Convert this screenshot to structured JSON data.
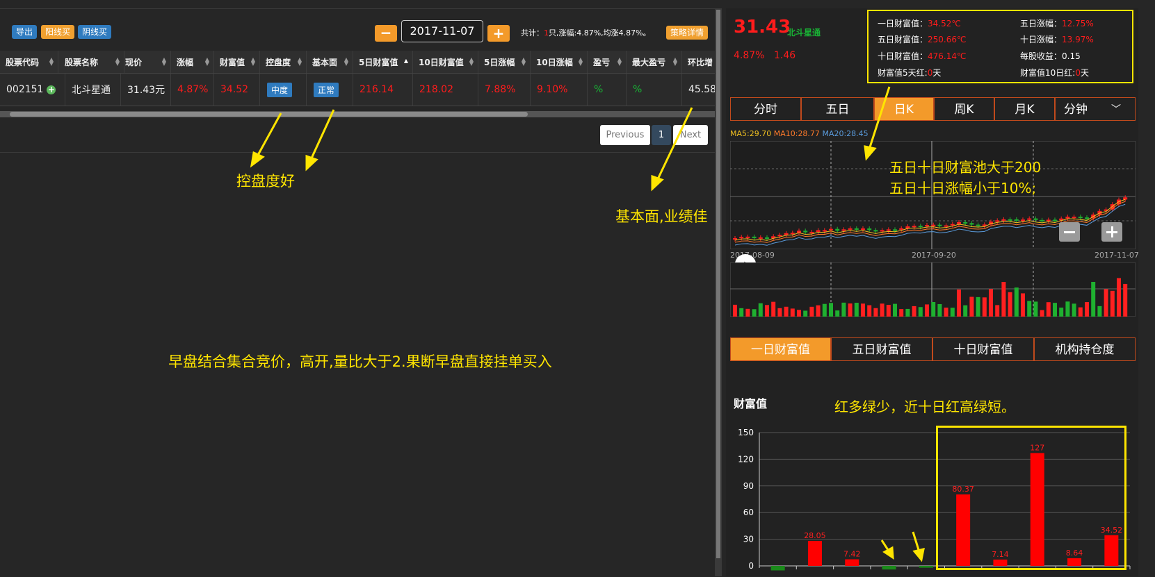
{
  "toolbar": {
    "export_label": "导出",
    "yang_buy_label": "阳线买",
    "yin_buy_label": "阴线买",
    "date_value": "2017-11-07",
    "minus_label": "−",
    "plus_label": "+",
    "summary_prefix": "共计：",
    "summary_count": "1",
    "summary_rest": "只,涨幅:4.87%,均涨4.87%。",
    "strategy_label": "策略详情"
  },
  "table": {
    "headers": [
      "股票代码",
      "股票名称",
      "现价",
      "涨幅",
      "财富值",
      "控盘度",
      "基本面",
      "5日财富值",
      "10日财富值",
      "5日涨幅",
      "10日涨幅",
      "盈亏",
      "最大盈亏",
      "环比增"
    ],
    "row": {
      "code": "002151",
      "name": "北斗星通",
      "price": "31.43元",
      "change": "4.87%",
      "wealth": "34.52",
      "control": "中度",
      "fundamental": "正常",
      "wealth5": "216.14",
      "wealth10": "218.02",
      "change5": "7.88%",
      "change10": "9.10%",
      "pnl": "%",
      "max_pnl": "%",
      "qoq": "45.58'"
    }
  },
  "pagination": {
    "previous": "Previous",
    "page": "1",
    "next": "Next"
  },
  "annotations": {
    "control_good": "控盘度好",
    "fundamental_good": "基本面,业绩佳",
    "buy_rule": "早盘结合集合竞价，高开,量比大于2.果断早盘直接挂单买入",
    "pool_line1": "五日十日财富池大于200",
    "pool_line2": "五日十日涨幅小于10%;",
    "red_green": "红多绿少，近十日红高绿短。"
  },
  "stock": {
    "price": "31.43",
    "name": "北斗星通",
    "change_pct": "4.87%",
    "change_amt": "1.46"
  },
  "info_box": {
    "w1_label": "一日财富值：",
    "w1_value": "34.52℃",
    "w5_label": "五日财富值：",
    "w5_value": "250.66℃",
    "w10_label": "十日财富值：",
    "w10_value": "476.14℃",
    "red5_label": "财富值5天红:",
    "red5_value": "0",
    "red5_unit": "天",
    "c5_label": "五日涨幅：",
    "c5_value": "12.75%",
    "c10_label": "十日涨幅：",
    "c10_value": "13.97%",
    "eps_label": "每股收益：",
    "eps_value": "0.15",
    "red10_label": "财富值10日红:",
    "red10_value": "0",
    "red10_unit": "天"
  },
  "period_tabs": [
    "分时",
    "五日",
    "日K",
    "周K",
    "月K",
    "分钟"
  ],
  "period_active": 2,
  "ma": {
    "ma5": "MA5:29.70",
    "ma10": "MA10:28.77",
    "ma20": "MA20:28.45"
  },
  "kline": {
    "dates": [
      "2017-08-09",
      "2017-09-20",
      "2017-11-07"
    ]
  },
  "wealth_tabs": [
    "一日财富值",
    "五日财富值",
    "十日财富值",
    "机构持仓度"
  ],
  "wealth_active": 0,
  "chart_data": {
    "type": "bar",
    "title": "财富值",
    "yticks": [
      0,
      30,
      60,
      90,
      120,
      150
    ],
    "ylim": [
      -5,
      150
    ],
    "values": [
      -5,
      28.05,
      7.42,
      -4,
      -2,
      80.37,
      7.14,
      127,
      8.64,
      34.52
    ],
    "labels": [
      "",
      "28.05",
      "7.42",
      "",
      "",
      "80.37",
      "7.14",
      "127",
      "8.64",
      "34.52"
    ],
    "colors": {
      "up": "#ff0000",
      "down": "#1a8a1a"
    }
  },
  "colors": {
    "accent": "#f39a2a",
    "highlight": "#ffe500",
    "red": "#ff1c1c",
    "green": "#19b235"
  }
}
